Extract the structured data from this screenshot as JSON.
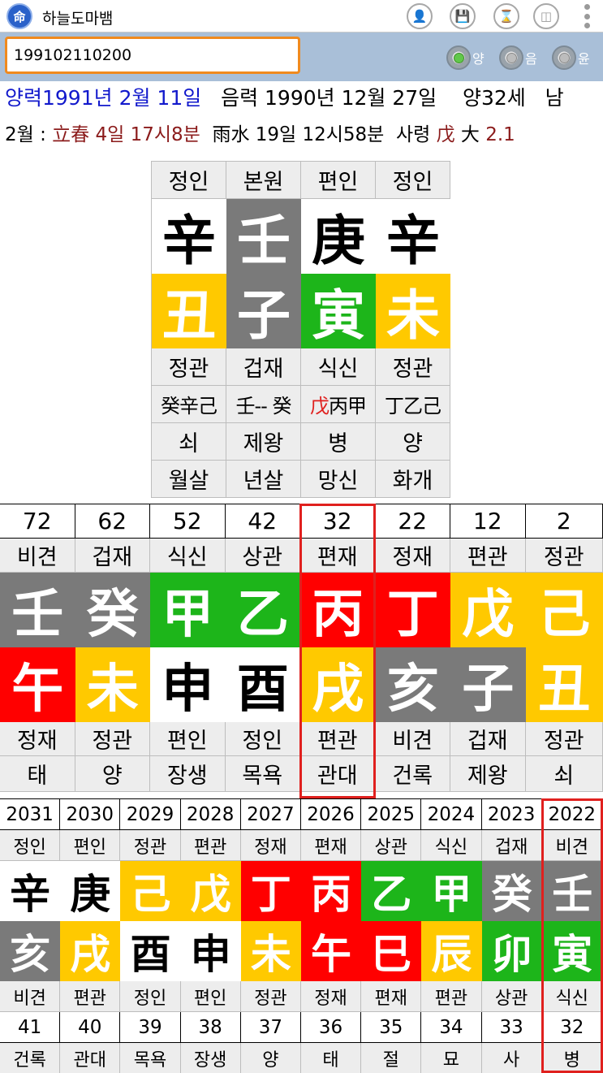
{
  "app": {
    "title": "하늘도마뱀",
    "icon_glyph": "命"
  },
  "toolbar": {
    "icons": [
      "add-person-icon",
      "save-icon",
      "hourglass-icon",
      "database-icon",
      "more-vert-icon"
    ]
  },
  "input": {
    "value": "199102110200"
  },
  "radios": [
    {
      "label": "양",
      "selected": true
    },
    {
      "label": "음",
      "selected": false
    },
    {
      "label": "윤",
      "selected": false
    }
  ],
  "info": {
    "solar": "양력1991년 2월 11일",
    "lunar": "음력 1990년 12월 27일",
    "age": "양32세",
    "gender": "남"
  },
  "term": {
    "month": "2월 :",
    "term1": "立春 4일 17시8분",
    "term2": "雨水 19일 12시58분",
    "saryeong_label": "사령",
    "saryeong_char": "戊",
    "dae_label": "大",
    "dae_num": "2.1"
  },
  "palja": {
    "top_labels": [
      "정인",
      "본원",
      "편인",
      "정인"
    ],
    "stems": [
      {
        "char": "辛",
        "color": "white"
      },
      {
        "char": "壬",
        "color": "gray"
      },
      {
        "char": "庚",
        "color": "white"
      },
      {
        "char": "辛",
        "color": "white"
      }
    ],
    "branches": [
      {
        "char": "丑",
        "color": "yellow"
      },
      {
        "char": "子",
        "color": "gray"
      },
      {
        "char": "寅",
        "color": "green"
      },
      {
        "char": "未",
        "color": "yellow"
      }
    ],
    "bottom_labels": [
      "정관",
      "겁재",
      "식신",
      "정관"
    ],
    "hidden": [
      {
        "prefix": "",
        "rest": "癸辛己"
      },
      {
        "prefix": "",
        "rest": "壬-- 癸"
      },
      {
        "prefix": "戊",
        "rest": "丙甲"
      },
      {
        "prefix": "",
        "rest": "丁乙己"
      }
    ],
    "stages": [
      "쇠",
      "제왕",
      "병",
      "양"
    ],
    "spirits": [
      "월살",
      "년살",
      "망신",
      "화개"
    ]
  },
  "daeun": {
    "ages": [
      "72",
      "62",
      "52",
      "42",
      "32",
      "22",
      "12",
      "2"
    ],
    "top_labels": [
      "비견",
      "겁재",
      "식신",
      "상관",
      "편재",
      "정재",
      "편관",
      "정관"
    ],
    "stems": [
      {
        "char": "壬",
        "color": "gray"
      },
      {
        "char": "癸",
        "color": "gray"
      },
      {
        "char": "甲",
        "color": "green"
      },
      {
        "char": "乙",
        "color": "green"
      },
      {
        "char": "丙",
        "color": "red"
      },
      {
        "char": "丁",
        "color": "red"
      },
      {
        "char": "戊",
        "color": "yellow"
      },
      {
        "char": "己",
        "color": "yellow"
      }
    ],
    "branches": [
      {
        "char": "午",
        "color": "red"
      },
      {
        "char": "未",
        "color": "yellow"
      },
      {
        "char": "申",
        "color": "white"
      },
      {
        "char": "酉",
        "color": "white"
      },
      {
        "char": "戌",
        "color": "yellow"
      },
      {
        "char": "亥",
        "color": "gray"
      },
      {
        "char": "子",
        "color": "gray"
      },
      {
        "char": "丑",
        "color": "yellow"
      }
    ],
    "bottom_labels": [
      "정재",
      "정관",
      "편인",
      "정인",
      "편관",
      "비견",
      "겁재",
      "정관"
    ],
    "stages": [
      "태",
      "양",
      "장생",
      "목욕",
      "관대",
      "건록",
      "제왕",
      "쇠"
    ],
    "selected_index": 4
  },
  "seun": {
    "years": [
      "2031",
      "2030",
      "2029",
      "2028",
      "2027",
      "2026",
      "2025",
      "2024",
      "2023",
      "2022"
    ],
    "top_labels": [
      "정인",
      "편인",
      "정관",
      "편관",
      "정재",
      "편재",
      "상관",
      "식신",
      "겁재",
      "비견"
    ],
    "stems": [
      {
        "char": "辛",
        "color": "white"
      },
      {
        "char": "庚",
        "color": "white"
      },
      {
        "char": "己",
        "color": "yellow"
      },
      {
        "char": "戊",
        "color": "yellow"
      },
      {
        "char": "丁",
        "color": "red"
      },
      {
        "char": "丙",
        "color": "red"
      },
      {
        "char": "乙",
        "color": "green"
      },
      {
        "char": "甲",
        "color": "green"
      },
      {
        "char": "癸",
        "color": "gray"
      },
      {
        "char": "壬",
        "color": "gray"
      }
    ],
    "branches": [
      {
        "char": "亥",
        "color": "gray"
      },
      {
        "char": "戌",
        "color": "yellow"
      },
      {
        "char": "酉",
        "color": "white"
      },
      {
        "char": "申",
        "color": "white"
      },
      {
        "char": "未",
        "color": "yellow"
      },
      {
        "char": "午",
        "color": "red"
      },
      {
        "char": "巳",
        "color": "red"
      },
      {
        "char": "辰",
        "color": "yellow"
      },
      {
        "char": "卯",
        "color": "green"
      },
      {
        "char": "寅",
        "color": "green"
      }
    ],
    "bottom_labels": [
      "비견",
      "편관",
      "정인",
      "편인",
      "정관",
      "정재",
      "편재",
      "편관",
      "상관",
      "식신"
    ],
    "ages": [
      "41",
      "40",
      "39",
      "38",
      "37",
      "36",
      "35",
      "34",
      "33",
      "32"
    ],
    "stages": [
      "건록",
      "관대",
      "목욕",
      "장생",
      "양",
      "태",
      "절",
      "묘",
      "사",
      "병"
    ],
    "selected_index": 9
  },
  "colors": {
    "white": "#ffffff",
    "gray": "#7a7a7a",
    "green": "#1db51a",
    "yellow": "#ffc900",
    "red": "#ff0000",
    "highlight_border": "#e0201e",
    "input_border": "#f08a1e",
    "solar_text": "#1219cc",
    "term_text": "#8b1b1b"
  }
}
